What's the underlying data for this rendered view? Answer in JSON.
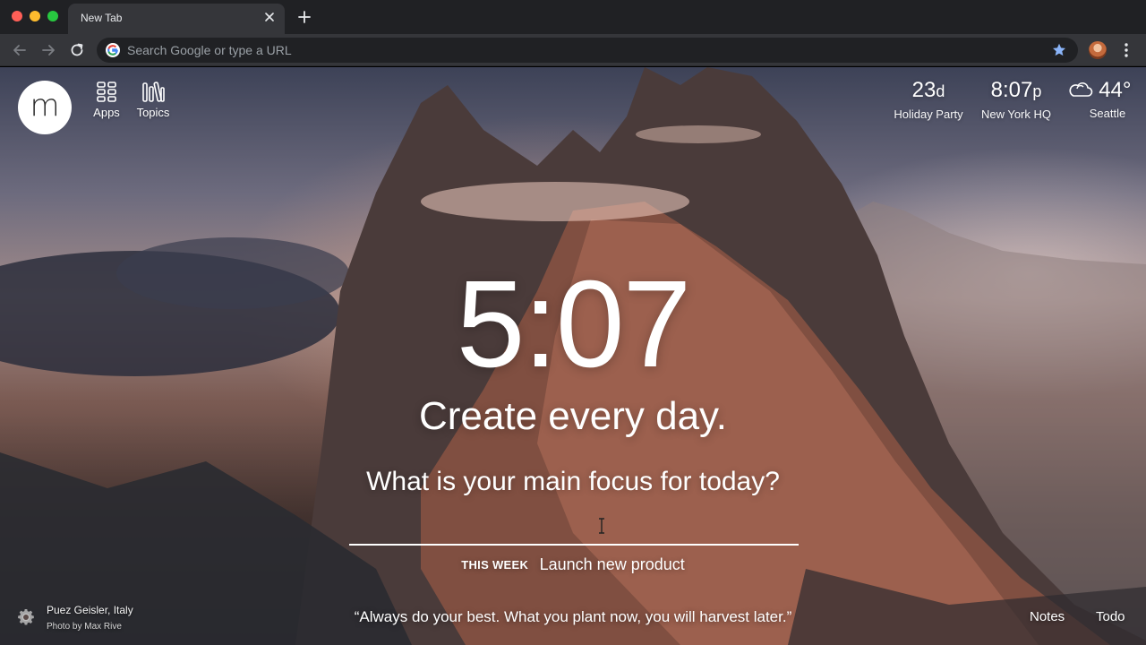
{
  "browser": {
    "tab_title": "New Tab",
    "omnibox_placeholder": "Search Google or type a URL"
  },
  "app": {
    "logo_letter": "m",
    "quicklinks": [
      {
        "label": "Apps",
        "icon": "apps-grid-icon"
      },
      {
        "label": "Topics",
        "icon": "topics-bars-icon"
      }
    ]
  },
  "widgets": {
    "countdown": {
      "value": "23",
      "unit": "d",
      "label": "Holiday Party"
    },
    "world_clock": {
      "value": "8:07",
      "unit": "p",
      "label": "New York HQ"
    },
    "weather": {
      "value": "44°",
      "label": "Seattle",
      "icon": "cloud-icon"
    }
  },
  "main": {
    "clock": "5:07",
    "mantra": "Create every day.",
    "focus_question": "What is your main focus for today?",
    "focus_value": "",
    "week_label": "THIS WEEK",
    "week_goal": "Launch new product"
  },
  "footer": {
    "photo_location": "Puez Geisler, Italy",
    "photo_credit": "Photo by Max Rive",
    "quote": "“Always do your best. What you plant now, you will harvest later.”",
    "notes_label": "Notes",
    "todo_label": "Todo"
  }
}
